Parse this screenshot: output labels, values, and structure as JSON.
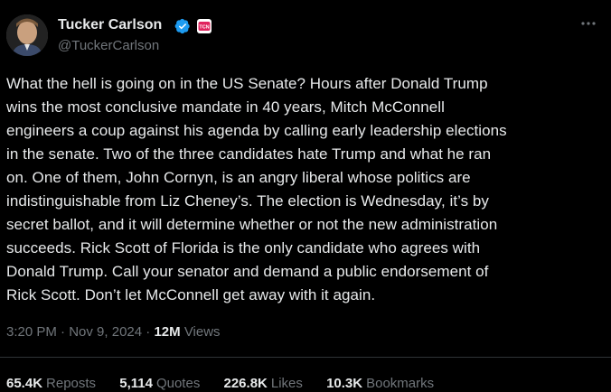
{
  "author": {
    "name": "Tucker Carlson",
    "handle": "@TuckerCarlson"
  },
  "tweet": {
    "text": "What the hell is going on in the US Senate? Hours after Donald Trump\nwins the most conclusive mandate in 40 years, Mitch McConnell\nengineers a coup against his agenda by calling early leadership elections\nin the senate. Two of the three candidates hate Trump and what he ran\non. One of them, John Cornyn, is an angry liberal whose politics are\nindistinguishable from Liz Cheney’s. The election is Wednesday, it’s by\nsecret ballot, and it will determine whether or not the new administration\nsucceeds. Rick Scott of Florida is the only candidate who agrees with\nDonald Trump. Call your senator and demand a public endorsement of\nRick Scott. Don’t let McConnell get away with it again.",
    "time": "3:20 PM",
    "date": "Nov 9, 2024",
    "separator": "·",
    "views_count": "12M",
    "views_label": "Views"
  },
  "stats": {
    "reposts": {
      "count": "65.4K",
      "label": "Reposts"
    },
    "quotes": {
      "count": "5,114",
      "label": "Quotes"
    },
    "likes": {
      "count": "226.8K",
      "label": "Likes"
    },
    "bookmarks": {
      "count": "10.3K",
      "label": "Bookmarks"
    }
  },
  "icons": {
    "verified": "verified-badge-icon",
    "affiliation": "affiliation-badge-icon",
    "more": "more-options-icon"
  },
  "colors": {
    "background": "#000000",
    "text": "#e7e9ea",
    "secondary": "#71767b",
    "verified": "#1d9bf0",
    "affiliation": "#e0245e"
  }
}
